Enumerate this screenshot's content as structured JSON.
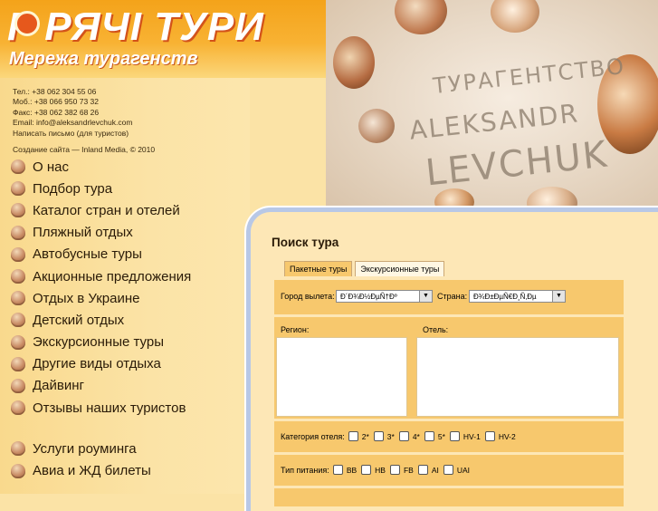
{
  "logo": {
    "title": "Г  РЯЧІ ТУРИ",
    "subtitle": "Мережа турагенств"
  },
  "contacts": {
    "phone": "Тел.:  +38 062 304 55 06",
    "mobile": "Моб.:  +38 066 950 73 32",
    "fax": "Факс: +38 062 382 68 26",
    "email": "Email: info@aleksandrlevchuk.com",
    "write_link": "Написать письмо (для туристов)"
  },
  "credit": "Создание сайта — Inland Media, © 2010",
  "menu": {
    "items": [
      "О нас",
      "Подбор тура",
      "Каталог стран и отелей",
      "Пляжный отдых",
      "Автобусные туры",
      "Акционные предложения",
      "Отдых в Украине",
      "Детский отдых",
      "Экскурсионные туры",
      "Другие виды отдыха",
      "Дайвинг",
      "Отзывы наших туристов"
    ],
    "extra": [
      "Услуги роуминга",
      "Авиа и ЖД билеты"
    ]
  },
  "photo": {
    "line1": "ТУРАГЕНТСТВО",
    "line2": "ALEKSANDR",
    "line3": "LEVCHUK"
  },
  "search": {
    "title": "Поиск тура",
    "tabs": [
      "Пакетные туры",
      "Экскурсионные туры"
    ],
    "departure_label": "Город вылета:",
    "departure_value": "Ð´Ð¾Ð½ÐµÑ†Ðº",
    "country_label": "Страна:",
    "country_value": "Ð¾Ð±ÐµÑ€Ð¸Ñ‚Ðµ",
    "region_label": "Регион:",
    "hotel_label": "Отель:",
    "category_label": "Категория отеля:",
    "categories": [
      "2*",
      "3*",
      "4*",
      "5*",
      "HV-1",
      "HV-2"
    ],
    "meal_label": "Тип питания:",
    "meals": [
      "BB",
      "HB",
      "FB",
      "AI",
      "UAI"
    ]
  }
}
